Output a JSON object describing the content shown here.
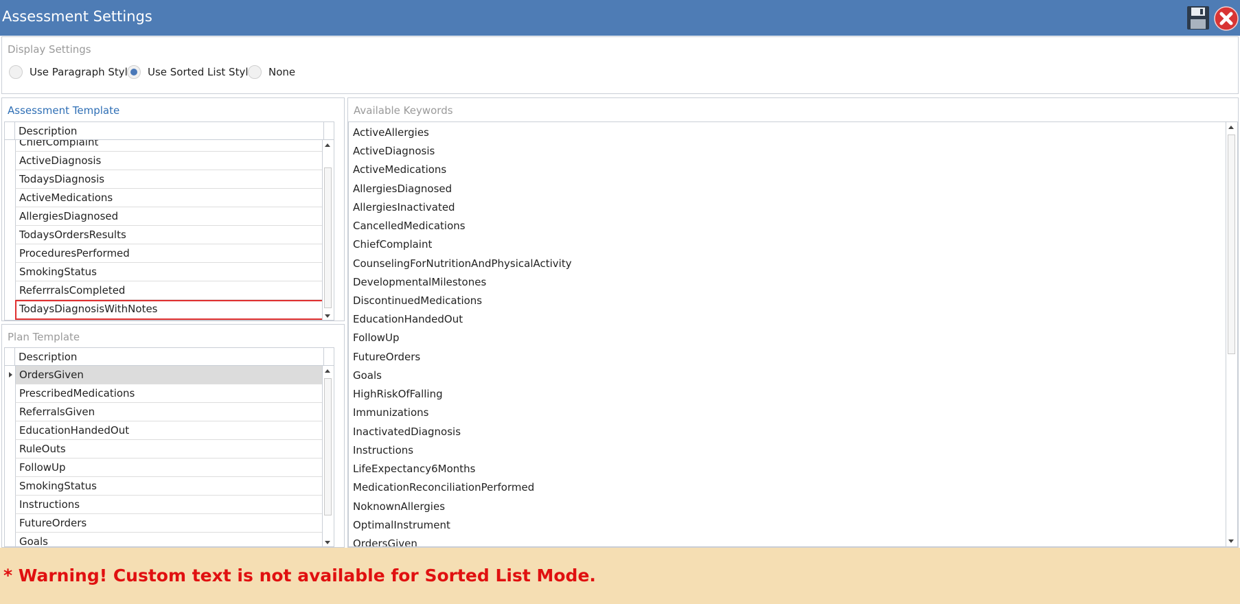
{
  "window": {
    "title": "Assessment Settings",
    "accent_color": "#4e7cb5",
    "icons": {
      "save": "floppy-disk-icon",
      "close": "red-x-close-icon"
    }
  },
  "display_settings": {
    "title": "Display Settings",
    "options": [
      {
        "label": "Use Paragraph Style",
        "checked": false
      },
      {
        "label": "Use Sorted List Style",
        "checked": true
      },
      {
        "label": "None",
        "checked": false
      }
    ]
  },
  "assessment_template": {
    "title": "Assessment Template",
    "column": "Description",
    "rows": [
      "ChiefComplaint",
      "ActiveDiagnosis",
      "TodaysDiagnosis",
      "ActiveMedications",
      "AllergiesDiagnosed",
      "TodaysOrdersResults",
      "ProceduresPerformed",
      "SmokingStatus",
      "ReferrralsCompleted",
      "TodaysDiagnosisWithNotes"
    ],
    "highlighted_row": "TodaysDiagnosisWithNotes"
  },
  "plan_template": {
    "title": "Plan Template",
    "column": "Description",
    "rows": [
      "OrdersGiven",
      "PrescribedMedications",
      "ReferralsGiven",
      "EducationHandedOut",
      "RuleOuts",
      "FollowUp",
      "SmokingStatus",
      "Instructions",
      "FutureOrders",
      "Goals"
    ],
    "selected_row": "OrdersGiven"
  },
  "available_keywords": {
    "title": "Available Keywords",
    "items": [
      "ActiveAllergies",
      "ActiveDiagnosis",
      "ActiveMedications",
      "AllergiesDiagnosed",
      "AllergiesInactivated",
      "CancelledMedications",
      "ChiefComplaint",
      "CounselingForNutritionAndPhysicalActivity",
      "DevelopmentalMilestones",
      "DiscontinuedMedications",
      "EducationHandedOut",
      "FollowUp",
      "FutureOrders",
      "Goals",
      "HighRiskOfFalling",
      "Immunizations",
      "InactivatedDiagnosis",
      "Instructions",
      "LifeExpectancy6Months",
      "MedicationReconciliationPerformed",
      "NoknownAllergies",
      "OptimalInstrument",
      "OrdersGiven"
    ]
  },
  "warning": {
    "text": "* Warning! Custom text is not available for Sorted List Mode.",
    "color": "#e01010",
    "background": "#f5deb3"
  }
}
